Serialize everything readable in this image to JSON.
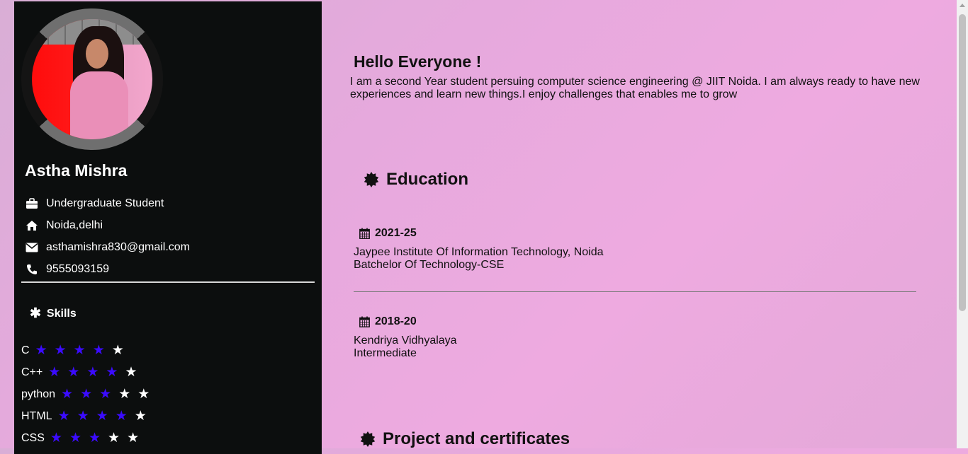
{
  "sidebar": {
    "name": "Astha Mishra",
    "info": [
      {
        "icon": "briefcase-icon",
        "text": "Undergraduate Student"
      },
      {
        "icon": "home-icon",
        "text": "Noida,delhi"
      },
      {
        "icon": "envelope-icon",
        "text": "asthamishra830@gmail.com"
      },
      {
        "icon": "phone-icon",
        "text": "9555093159"
      }
    ],
    "skills_title": "Skills",
    "skills": [
      {
        "name": "C",
        "rating": 4,
        "max": 5
      },
      {
        "name": "C++",
        "rating": 4,
        "max": 5
      },
      {
        "name": "python",
        "rating": 3,
        "max": 5
      },
      {
        "name": "HTML",
        "rating": 4,
        "max": 5
      },
      {
        "name": "CSS",
        "rating": 3,
        "max": 5
      }
    ]
  },
  "main": {
    "greeting": "Hello Everyone !",
    "intro": "I am a second Year student persuing computer science engineering @ JIIT Noida. I am always ready to have new experiences and learn new things.I enjoy challenges that enables me to grow",
    "education_title": "Education",
    "education": [
      {
        "years": "2021-25",
        "institution": "Jaypee Institute Of Information Technology, Noida",
        "degree": "Batchelor Of Technology-CSE"
      },
      {
        "years": "2018-20",
        "institution": "Kendriya Vidhyalaya",
        "degree": "Intermediate"
      }
    ],
    "projects_title": "Project and certificates"
  },
  "colors": {
    "star_filled": "#3b0bff",
    "star_empty": "#ffffff",
    "sidebar_bg": "#0c0e0e"
  }
}
